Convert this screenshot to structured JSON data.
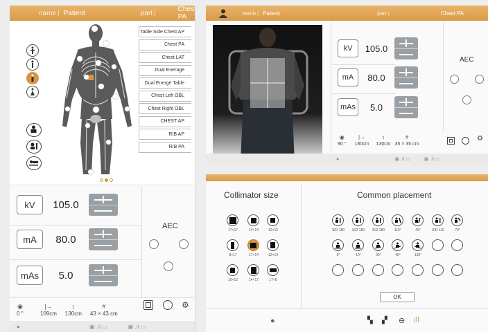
{
  "header": {
    "name_label": "name",
    "patient": "Patient",
    "part_label": "part",
    "part_value": "Chest PA"
  },
  "protocols": [
    "Table Side Chest AP",
    "Chest PA",
    "Chest LAT",
    "Dual Enerage",
    "Dual Energe Table",
    "Chest Left OBL",
    "Chest Right OBL",
    "CHEST AP",
    "RIB AP",
    "RIB PA"
  ],
  "exposure": {
    "kv_label": "kV",
    "kv": "105.0",
    "ma_label": "mA",
    "ma": "80.0",
    "mas_label": "mAs",
    "mas": "5.0"
  },
  "aec_label": "AEC",
  "info_p1": {
    "angle": "0 °",
    "sid": "109cm",
    "height": "130cm",
    "field": "43 × 43 cm"
  },
  "info_p2": {
    "angle": "90 °",
    "sid": "180cm",
    "height": "130cm",
    "field": "35 × 35 cm"
  },
  "collimator": {
    "title": "Collimator size",
    "sizes": [
      "17×17",
      "14×14",
      "12×12",
      "8×17",
      "17×14",
      "12×14",
      "10×12",
      "14×17",
      "17×8"
    ]
  },
  "placement": {
    "title": "Common placement",
    "row1": [
      "SID 180",
      "SID 180",
      "SID 180",
      "115°",
      "45°",
      "SID 110",
      "70°"
    ],
    "row2": [
      "0°",
      "10°",
      "30°",
      "45°",
      "135°"
    ]
  },
  "ok_label": "OK",
  "colors": {
    "accent": "#d69545",
    "panel": "#fafafa"
  }
}
